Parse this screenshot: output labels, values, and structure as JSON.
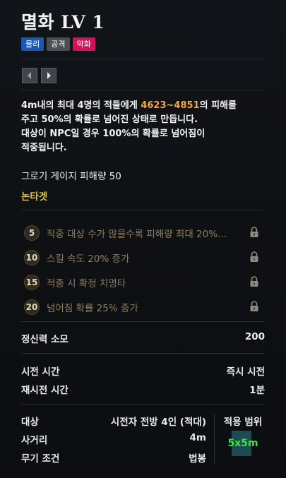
{
  "skill": {
    "title": "멸화 LV 1",
    "tags": [
      {
        "label": "물리",
        "color": "#1c57b4"
      },
      {
        "label": "공격",
        "color": "#4b4f55"
      },
      {
        "label": "약화",
        "color": "#d2135b"
      }
    ]
  },
  "nav": {
    "prev_icon": "chevron-left-icon",
    "next_icon": "chevron-right-icon"
  },
  "description": {
    "line1_a": "4m내의 최대 4명의 적들에게 ",
    "line1_num": "4623~4851",
    "line1_b": "의 피해를",
    "line2": "주고 50%의 확률로 넘어진 상태로 만듭니다.",
    "line3": "대상이 NPC일 경우 100%의 확률로 넘어짐이",
    "line4": "적중됩니다."
  },
  "groggy": "그로기 게이지 피해량 50",
  "nontarget": "논타겟",
  "tripods": [
    {
      "level": "5",
      "text": "적중 대상 수가 많을수록 피해량 최대 20%..."
    },
    {
      "level": "10",
      "text": "스킬 속도 20% 증가"
    },
    {
      "level": "15",
      "text": "적중 시 확정 치명타"
    },
    {
      "level": "20",
      "text": "넘어짐 확률 25% 증가"
    }
  ],
  "stats": {
    "mana_label": "정신력 소모",
    "mana_value": "200",
    "cast_label": "시전 시간",
    "cast_value": "즉시 시전",
    "cooldown_label": "재시전 시간",
    "cooldown_value": "1분",
    "target_label": "대상",
    "target_value": "시전자 전방 4인 (적대)",
    "range_label": "사거리",
    "range_value": "4m",
    "weapon_label": "무기 조건",
    "weapon_value": "법봉",
    "area_label": "적용 범위",
    "area_value": "5x5m"
  },
  "colors": {
    "accent_orange": "#f0a846",
    "nontarget_yellow": "#e2c23a",
    "area_green": "#3be33f"
  }
}
